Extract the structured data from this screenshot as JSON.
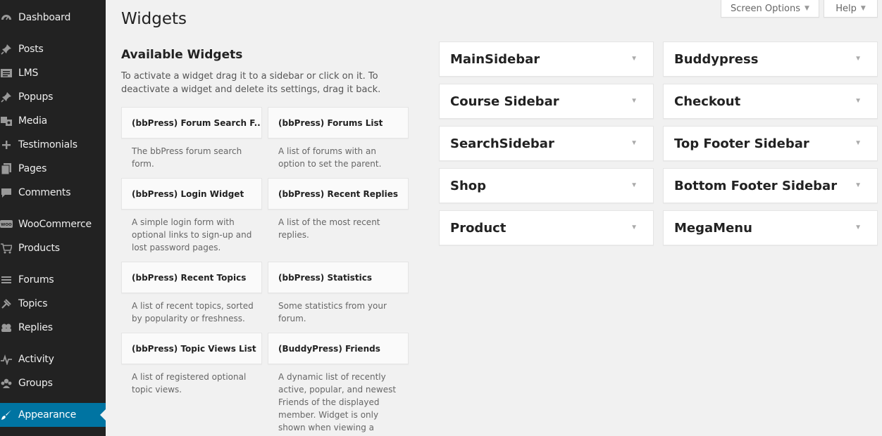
{
  "menu": {
    "dashboard": "Dashboard",
    "posts": "Posts",
    "lms": "LMS",
    "popups": "Popups",
    "media": "Media",
    "testimonials": "Testimonials",
    "pages": "Pages",
    "comments": "Comments",
    "woocommerce": "WooCommerce",
    "woo_icon_text": "WOO",
    "products": "Products",
    "forums": "Forums",
    "topics": "Topics",
    "replies": "Replies",
    "activity": "Activity",
    "groups": "Groups",
    "appearance": "Appearance"
  },
  "meta": {
    "screen_options": "Screen Options",
    "help": "Help"
  },
  "page": {
    "title": "Widgets",
    "available_title": "Available Widgets",
    "available_desc": "To activate a widget drag it to a sidebar or click on it. To deactivate a widget and delete its settings, drag it back."
  },
  "widgets": [
    {
      "title": "(bbPress) Forum Search F...",
      "desc": "The bbPress forum search form."
    },
    {
      "title": "(bbPress) Forums List",
      "desc": "A list of forums with an option to set the parent."
    },
    {
      "title": "(bbPress) Login Widget",
      "desc": "A simple login form with optional links to sign-up and lost password pages."
    },
    {
      "title": "(bbPress) Recent Replies",
      "desc": "A list of the most recent replies."
    },
    {
      "title": "(bbPress) Recent Topics",
      "desc": "A list of recent topics, sorted by popularity or freshness."
    },
    {
      "title": "(bbPress) Statistics",
      "desc": "Some statistics from your forum."
    },
    {
      "title": "(bbPress) Topic Views List",
      "desc": "A list of registered optional topic views."
    },
    {
      "title": "(BuddyPress) Friends",
      "desc": "A dynamic list of recently active, popular, and newest Friends of the displayed member. Widget is only shown when viewing a"
    }
  ],
  "sidebars": [
    "MainSidebar",
    "Buddypress",
    "Course Sidebar",
    "Checkout",
    "SearchSidebar",
    "Top Footer Sidebar",
    "Shop",
    "Bottom Footer Sidebar",
    "Product",
    "MegaMenu"
  ],
  "colors": {
    "menu_bg": "#222222",
    "menu_current": "#0074a2",
    "page_bg": "#f1f1f1"
  }
}
